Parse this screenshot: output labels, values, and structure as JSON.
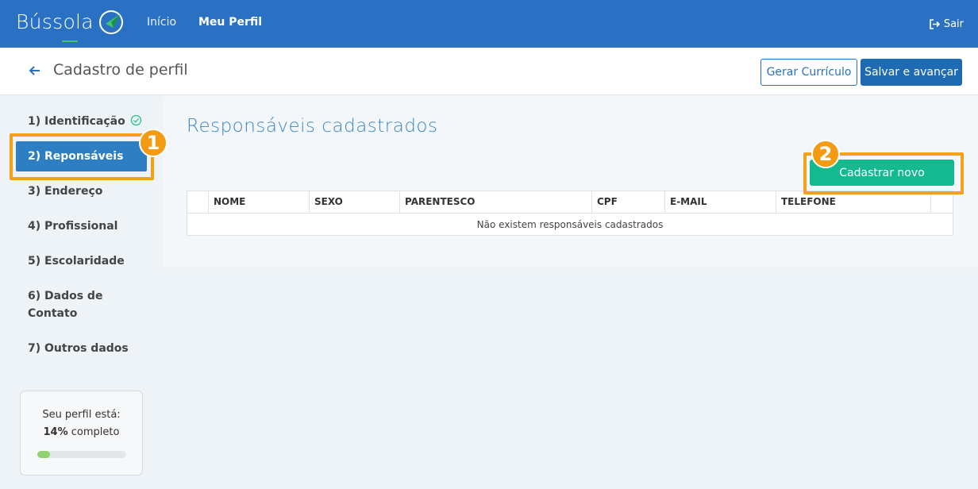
{
  "app": {
    "logo": "Bússola"
  },
  "nav": {
    "inicio": "Início",
    "meu_perfil": "Meu Perfil",
    "logout": "Sair"
  },
  "header": {
    "title": "Cadastro de perfil",
    "btn_curriculo": "Gerar Currículo",
    "btn_salvar": "Salvar e avançar"
  },
  "sidebar": {
    "items": [
      {
        "label": "1) Identificação",
        "done": true
      },
      {
        "label": "2) Reponsáveis",
        "active": true
      },
      {
        "label": "3) Endereço"
      },
      {
        "label": "4) Profissional"
      },
      {
        "label": "5) Escolaridade"
      },
      {
        "label": "6) Dados de Contato"
      },
      {
        "label": "7) Outros dados"
      }
    ],
    "progress": {
      "label": "Seu perfil está:",
      "percent": "14%",
      "suffix": "completo",
      "value": 0.14
    }
  },
  "main": {
    "title": "Responsáveis cadastrados",
    "btn_new": "Cadastrar novo",
    "table": {
      "columns": [
        "NOME",
        "SEXO",
        "PARENTESCO",
        "CPF",
        "E-MAIL",
        "TELEFONE"
      ],
      "empty_message": "Não existem responsáveis cadastrados"
    }
  },
  "callouts": {
    "one": "1",
    "two": "2"
  },
  "colors": {
    "topbar": "#2a71c3",
    "accent": "#14b990",
    "callout": "#f5a01a"
  }
}
